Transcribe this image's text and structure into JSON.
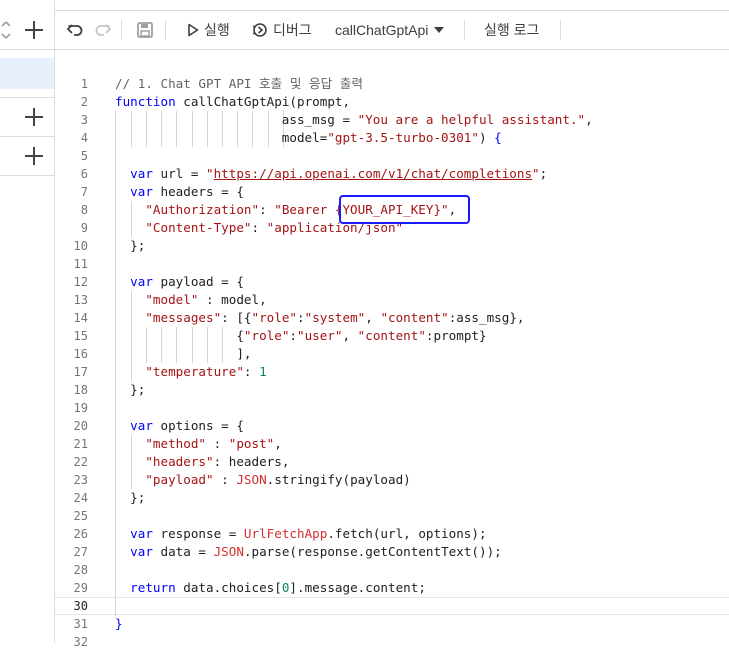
{
  "toolbar": {
    "run_label": "실행",
    "debug_label": "디버그",
    "function_name": "callChatGptApi",
    "log_label": "실행 로그"
  },
  "code": {
    "lines": [
      {
        "n": "1",
        "parts": [
          {
            "t": "// 1. Chat GPT API 호출 및 응답 출력",
            "c": "cm"
          }
        ]
      },
      {
        "n": "2",
        "parts": [
          {
            "t": "function",
            "c": "kw"
          },
          {
            "t": " callChatGptApi(prompt,",
            "c": "fn"
          }
        ]
      },
      {
        "n": "3",
        "parts": [
          {
            "t": "                      ass_msg = ",
            "c": "fn"
          },
          {
            "t": "\"You are a helpful assistant.\"",
            "c": "str"
          },
          {
            "t": ",",
            "c": "fn"
          }
        ]
      },
      {
        "n": "4",
        "parts": [
          {
            "t": "                      model=",
            "c": "fn"
          },
          {
            "t": "\"gpt-3.5-turbo-0301\"",
            "c": "str"
          },
          {
            "t": ") ",
            "c": "fn"
          },
          {
            "t": "{",
            "c": "brk"
          }
        ]
      },
      {
        "n": "5",
        "parts": []
      },
      {
        "n": "6",
        "parts": [
          {
            "t": "  var",
            "c": "kw"
          },
          {
            "t": " url = ",
            "c": "fn"
          },
          {
            "t": "\"",
            "c": "str"
          },
          {
            "t": "https://api.openai.com/v1/chat/completions",
            "c": "url"
          },
          {
            "t": "\"",
            "c": "str"
          },
          {
            "t": ";",
            "c": "fn"
          }
        ]
      },
      {
        "n": "7",
        "parts": [
          {
            "t": "  var",
            "c": "kw"
          },
          {
            "t": " headers = {",
            "c": "fn"
          }
        ]
      },
      {
        "n": "8",
        "parts": [
          {
            "t": "    \"Authorization\"",
            "c": "str"
          },
          {
            "t": ": ",
            "c": "fn"
          },
          {
            "t": "\"Bearer {YOUR_API_KEY}\"",
            "c": "str"
          },
          {
            "t": ",",
            "c": "fn"
          }
        ]
      },
      {
        "n": "9",
        "parts": [
          {
            "t": "    \"Content-Type\"",
            "c": "str"
          },
          {
            "t": ": ",
            "c": "fn"
          },
          {
            "t": "\"application/json\"",
            "c": "str"
          }
        ]
      },
      {
        "n": "10",
        "parts": [
          {
            "t": "  };",
            "c": "fn"
          }
        ]
      },
      {
        "n": "11",
        "parts": []
      },
      {
        "n": "12",
        "parts": [
          {
            "t": "  var",
            "c": "kw"
          },
          {
            "t": " payload = {",
            "c": "fn"
          }
        ]
      },
      {
        "n": "13",
        "parts": [
          {
            "t": "    \"model\"",
            "c": "str"
          },
          {
            "t": " : model,",
            "c": "fn"
          }
        ]
      },
      {
        "n": "14",
        "parts": [
          {
            "t": "    \"messages\"",
            "c": "str"
          },
          {
            "t": ": [{",
            "c": "fn"
          },
          {
            "t": "\"role\"",
            "c": "str"
          },
          {
            "t": ":",
            "c": "fn"
          },
          {
            "t": "\"system\"",
            "c": "str"
          },
          {
            "t": ", ",
            "c": "fn"
          },
          {
            "t": "\"content\"",
            "c": "str"
          },
          {
            "t": ":ass_msg},",
            "c": "fn"
          }
        ]
      },
      {
        "n": "15",
        "parts": [
          {
            "t": "                {",
            "c": "fn"
          },
          {
            "t": "\"role\"",
            "c": "str"
          },
          {
            "t": ":",
            "c": "fn"
          },
          {
            "t": "\"user\"",
            "c": "str"
          },
          {
            "t": ", ",
            "c": "fn"
          },
          {
            "t": "\"content\"",
            "c": "str"
          },
          {
            "t": ":prompt}",
            "c": "fn"
          }
        ]
      },
      {
        "n": "16",
        "parts": [
          {
            "t": "                ],",
            "c": "fn"
          }
        ]
      },
      {
        "n": "17",
        "parts": [
          {
            "t": "    \"temperature\"",
            "c": "str"
          },
          {
            "t": ": ",
            "c": "fn"
          },
          {
            "t": "1",
            "c": "num"
          }
        ]
      },
      {
        "n": "18",
        "parts": [
          {
            "t": "  };",
            "c": "fn"
          }
        ]
      },
      {
        "n": "19",
        "parts": []
      },
      {
        "n": "20",
        "parts": [
          {
            "t": "  var",
            "c": "kw"
          },
          {
            "t": " options = {",
            "c": "fn"
          }
        ]
      },
      {
        "n": "21",
        "parts": [
          {
            "t": "    \"method\"",
            "c": "str"
          },
          {
            "t": " : ",
            "c": "fn"
          },
          {
            "t": "\"post\"",
            "c": "str"
          },
          {
            "t": ",",
            "c": "fn"
          }
        ]
      },
      {
        "n": "22",
        "parts": [
          {
            "t": "    \"headers\"",
            "c": "str"
          },
          {
            "t": ": headers,",
            "c": "fn"
          }
        ]
      },
      {
        "n": "23",
        "parts": [
          {
            "t": "    \"payload\"",
            "c": "str"
          },
          {
            "t": " : ",
            "c": "fn"
          },
          {
            "t": "JSON",
            "c": "obj"
          },
          {
            "t": ".stringify(payload)",
            "c": "fn"
          }
        ]
      },
      {
        "n": "24",
        "parts": [
          {
            "t": "  };",
            "c": "fn"
          }
        ]
      },
      {
        "n": "25",
        "parts": []
      },
      {
        "n": "26",
        "parts": [
          {
            "t": "  var",
            "c": "kw"
          },
          {
            "t": " response = ",
            "c": "fn"
          },
          {
            "t": "UrlFetchApp",
            "c": "obj"
          },
          {
            "t": ".fetch(url, options);",
            "c": "fn"
          }
        ]
      },
      {
        "n": "27",
        "parts": [
          {
            "t": "  var",
            "c": "kw"
          },
          {
            "t": " data = ",
            "c": "fn"
          },
          {
            "t": "JSON",
            "c": "obj"
          },
          {
            "t": ".parse(response.getContentText());",
            "c": "fn"
          }
        ]
      },
      {
        "n": "28",
        "parts": []
      },
      {
        "n": "29",
        "parts": [
          {
            "t": "  return",
            "c": "kw"
          },
          {
            "t": " data.choices[",
            "c": "fn"
          },
          {
            "t": "0",
            "c": "num"
          },
          {
            "t": "].message.content;",
            "c": "fn"
          }
        ]
      },
      {
        "n": "30",
        "parts": []
      },
      {
        "n": "31",
        "parts": [
          {
            "t": "}",
            "c": "brk"
          }
        ]
      },
      {
        "n": "32",
        "parts": []
      }
    ]
  }
}
